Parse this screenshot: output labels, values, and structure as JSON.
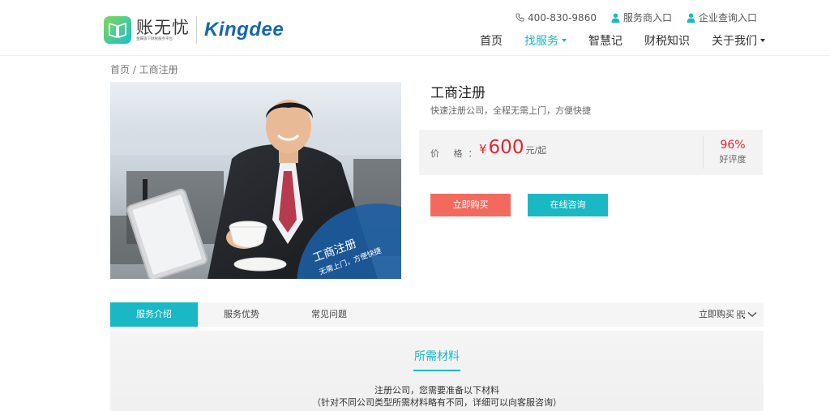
{
  "header": {
    "logo": {
      "cn": "账无忧",
      "tagline": "金蝶旗下财税服务平台",
      "brand": "Kingdee"
    },
    "topbar": {
      "phone": "400-830-9860",
      "provider_entry": "服务商入口",
      "enterprise_entry": "企业查询入口"
    },
    "nav": [
      "首页",
      "找服务",
      "智慧记",
      "财税知识",
      "关于我们"
    ]
  },
  "breadcrumb": "首页 / 工商注册",
  "hero": {
    "overlay_title": "工商注册",
    "overlay_sub": "无需上门，方便快捷"
  },
  "product": {
    "title": "工商注册",
    "subtitle": "快速注册公司，全程无需上门，方便快捷",
    "price_label": "价 格：",
    "price_currency": "¥",
    "price_value": "600",
    "price_unit": "元/起",
    "rating_value": "96%",
    "rating_label": "好评度",
    "buy_label": "立即购买",
    "consult_label": "在线咨询"
  },
  "tabs": {
    "items": [
      "服务介绍",
      "服务优势",
      "常见问题"
    ],
    "buy_label": "立即购买"
  },
  "section": {
    "title": "所需材料",
    "line1": "注册公司，您需要准备以下材料",
    "line2": "（针对不同公司类型所需材料略有不同，详细可以向客服咨询）"
  },
  "colors": {
    "accent": "#1ab8c4",
    "price": "#e3252f",
    "buy_button": "#f26a5e"
  }
}
